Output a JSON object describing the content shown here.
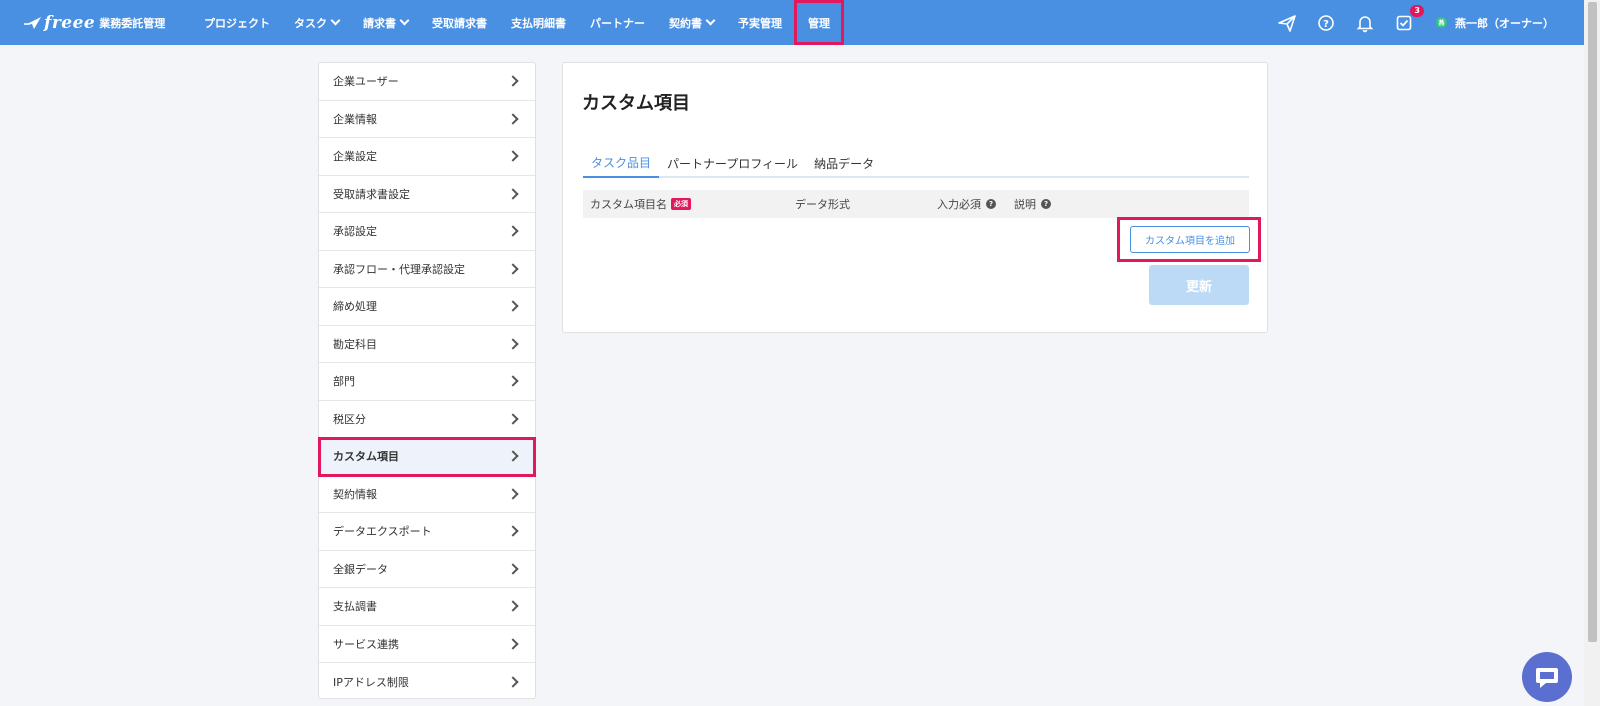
{
  "header": {
    "brand": "freee",
    "product": "業務委託管理",
    "nav": [
      {
        "label": "プロジェクト",
        "dropdown": false
      },
      {
        "label": "タスク",
        "dropdown": true
      },
      {
        "label": "請求書",
        "dropdown": true
      },
      {
        "label": "受取請求書",
        "dropdown": false
      },
      {
        "label": "支払明細書",
        "dropdown": false
      },
      {
        "label": "パートナー",
        "dropdown": false
      },
      {
        "label": "契約書",
        "dropdown": true
      },
      {
        "label": "予実管理",
        "dropdown": false
      },
      {
        "label": "管理",
        "dropdown": false,
        "highlighted": true
      }
    ],
    "notification_count": "3",
    "user_initial": "燕",
    "user_name": "燕一郎（オーナー）"
  },
  "sidebar": {
    "items": [
      {
        "label": "企業ユーザー"
      },
      {
        "label": "企業情報"
      },
      {
        "label": "企業設定"
      },
      {
        "label": "受取請求書設定"
      },
      {
        "label": "承認設定"
      },
      {
        "label": "承認フロー・代理承認設定"
      },
      {
        "label": "締め処理"
      },
      {
        "label": "勘定科目"
      },
      {
        "label": "部門"
      },
      {
        "label": "税区分"
      },
      {
        "label": "カスタム項目",
        "active": true
      },
      {
        "label": "契約情報"
      },
      {
        "label": "データエクスポート"
      },
      {
        "label": "全銀データ"
      },
      {
        "label": "支払調書"
      },
      {
        "label": "サービス連携"
      },
      {
        "label": "IPアドレス制限"
      }
    ]
  },
  "main": {
    "title": "カスタム項目",
    "tabs": [
      {
        "label": "タスク品目",
        "active": true
      },
      {
        "label": "パートナープロフィール"
      },
      {
        "label": "納品データ"
      }
    ],
    "table": {
      "columns": {
        "name": "カスタム項目名",
        "required_badge": "必須",
        "data_type": "データ形式",
        "input_required": "入力必須",
        "description": "説明"
      },
      "help_glyph": "?"
    },
    "add_button": "カスタム項目を追加",
    "update_button": "更新"
  },
  "colors": {
    "header_bg": "#4a90e2",
    "accent": "#4a90e2",
    "highlight": "#e2185c",
    "update_disabled": "#bcdaf6"
  }
}
